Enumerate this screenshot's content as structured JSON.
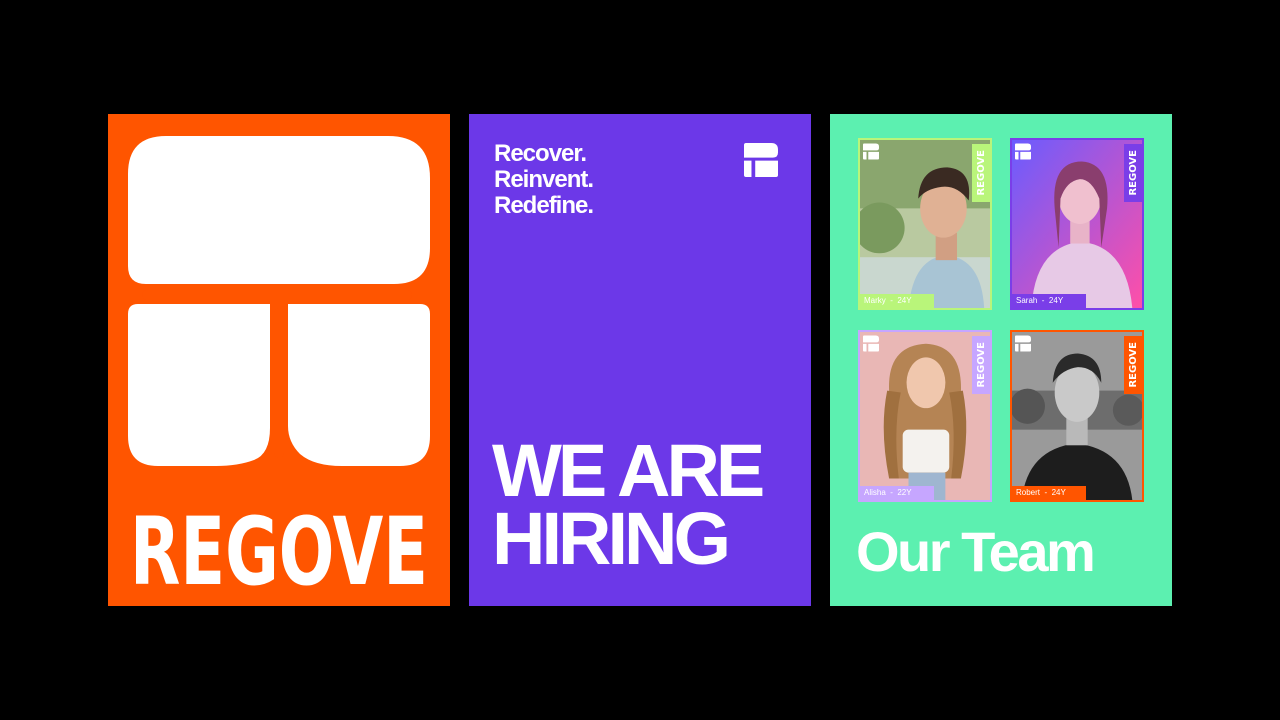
{
  "brand": {
    "wordmark": "REGOVE",
    "colors": {
      "orange": "#ff5500",
      "purple": "#6c38e8",
      "mint": "#5cf0b0",
      "white": "#ffffff",
      "black": "#000000"
    }
  },
  "hiring_poster": {
    "tagline": [
      "Recover.",
      "Reinvent.",
      "Redefine."
    ],
    "headline": [
      "WE ARE",
      "HIRING"
    ]
  },
  "team_poster": {
    "title": "Our Team",
    "members": [
      {
        "name": "Marky",
        "age": "24Y",
        "vertical_label": "REGOVE",
        "accent": "#b9f57a"
      },
      {
        "name": "Sarah",
        "age": "24Y",
        "vertical_label": "REGOVE",
        "accent": "#7a3ee8"
      },
      {
        "name": "Alisha",
        "age": "22Y",
        "vertical_label": "REGOVE",
        "accent": "#c6a6ff"
      },
      {
        "name": "Robert",
        "age": "24Y",
        "vertical_label": "REGOVE",
        "accent": "#ff5500"
      }
    ]
  }
}
